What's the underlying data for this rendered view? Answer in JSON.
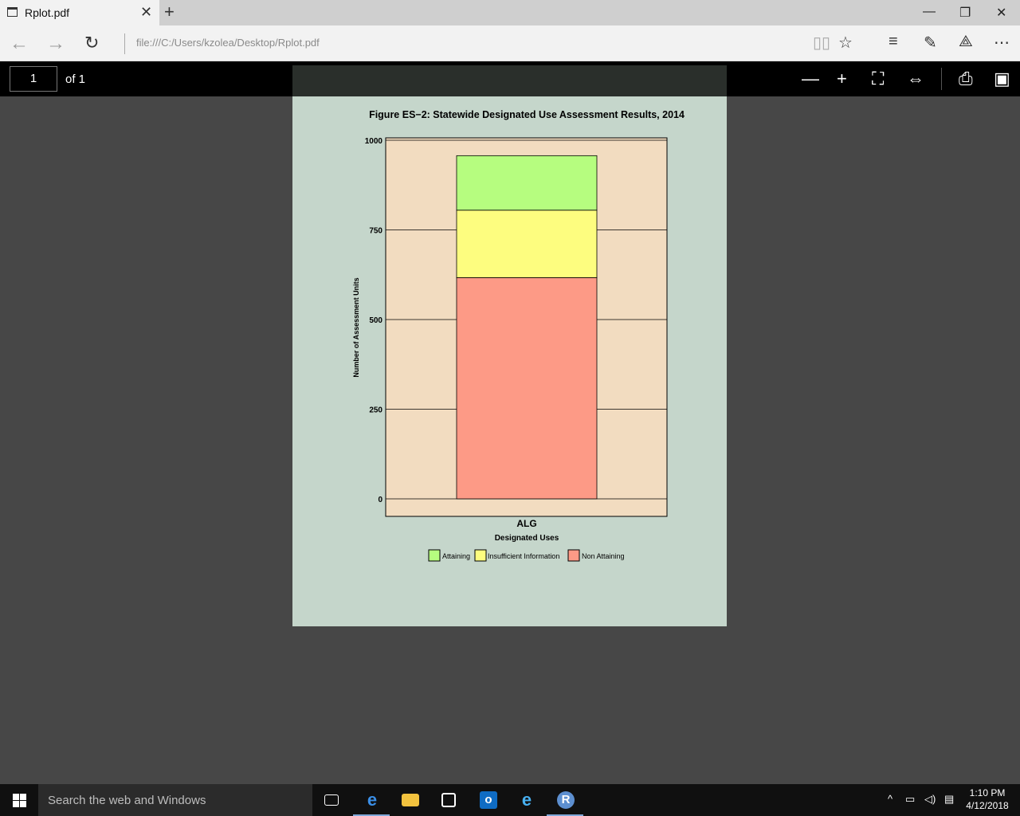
{
  "browser": {
    "tab_title": "Rplot.pdf",
    "new_tab_label": "+",
    "url": "file:///C:/Users/kzolea/Desktop/Rplot.pdf"
  },
  "pdf_toolbar": {
    "page_number": "1",
    "page_of": "of 1"
  },
  "taskbar": {
    "search_placeholder": "Search the web and Windows",
    "time": "1:10 PM",
    "date": "4/12/2018"
  },
  "colors": {
    "plot_bg": "#f2dcc0",
    "page_bg": "#c5d6cb",
    "attaining": "#b6fd7f",
    "insufficient": "#fdfd7f",
    "non_attaining": "#fd9a86"
  },
  "chart_data": {
    "type": "bar",
    "stacked": true,
    "title": "Figure ES−2: Statewide Designated Use Assessment Results, 2014",
    "xlabel": "Designated Uses",
    "ylabel": "Number of Assessment Units",
    "categories": [
      "ALG"
    ],
    "yticks": [
      "0",
      "250",
      "500",
      "750",
      "1000"
    ],
    "ylim": [
      -50,
      1000
    ],
    "grid": true,
    "legend_position": "bottom",
    "series": [
      {
        "name": "Non Attaining",
        "values": [
          617
        ],
        "color": "#fd9a86"
      },
      {
        "name": "Insufficient Information",
        "values": [
          188
        ],
        "color": "#fdfd7f"
      },
      {
        "name": "Attaining",
        "values": [
          152
        ],
        "color": "#b6fd7f"
      }
    ],
    "legend_order": [
      "Attaining",
      "Insufficient Information",
      "Non Attaining"
    ]
  }
}
